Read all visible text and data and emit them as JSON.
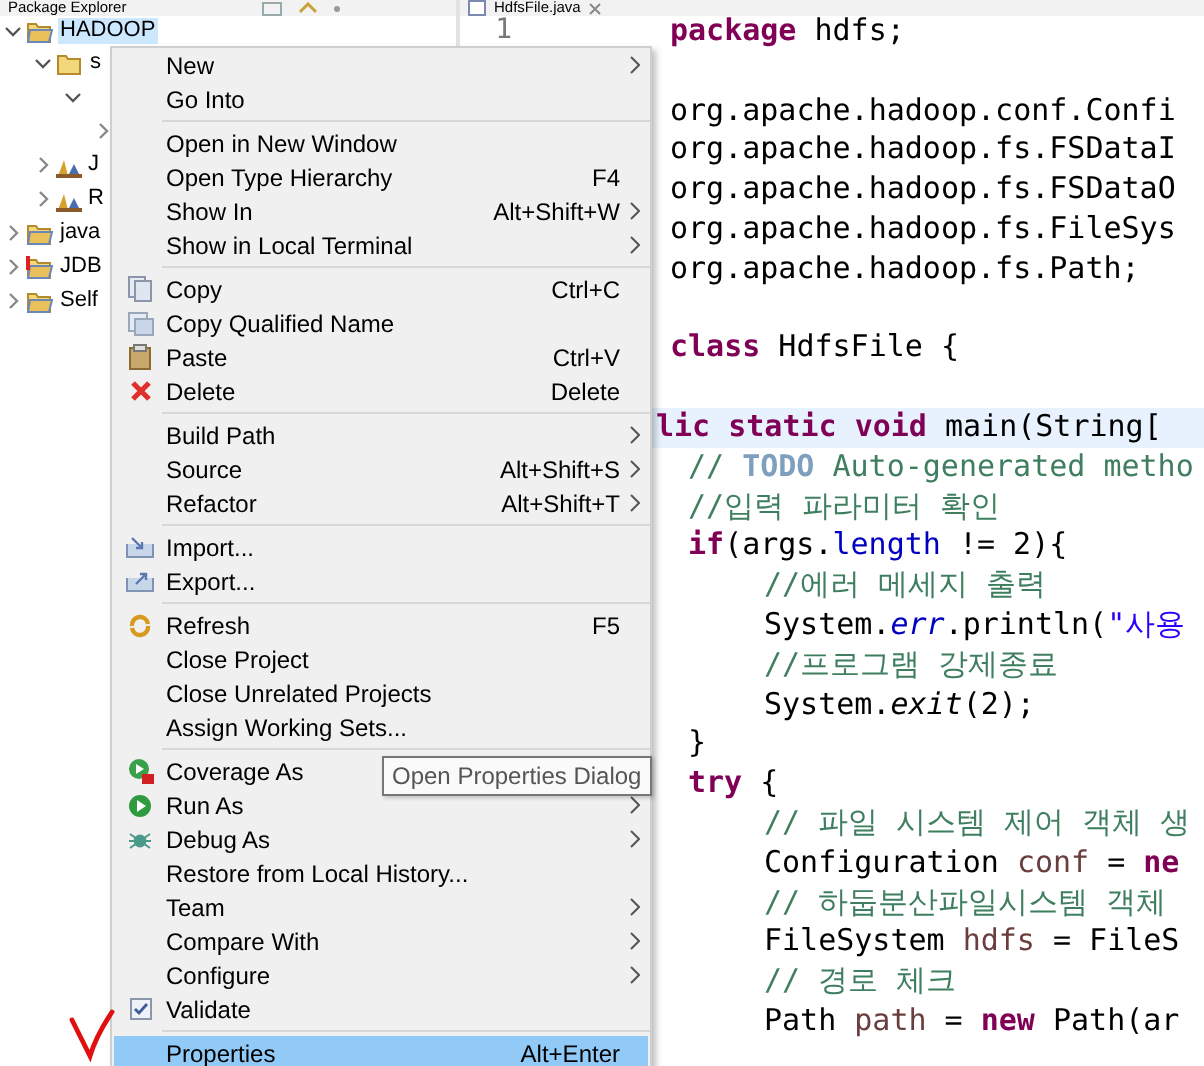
{
  "tabs": [
    {
      "label": "Package Explorer",
      "selected": true
    },
    {
      "label": "HdfsFile.java",
      "selected": true
    }
  ],
  "tree": [
    {
      "label": "HADOOP",
      "kind": "project",
      "expanded": true,
      "selected": true,
      "error": false,
      "children": [
        {
          "label": "s",
          "kind": "source-folder",
          "expanded": true,
          "selected": false,
          "children": [
            {
              "expanded": true,
              "children": [
                {
                  "expanded": false
                }
              ]
            }
          ]
        },
        {
          "label": "J",
          "kind": "library",
          "expanded": false,
          "selected": false
        },
        {
          "label": "R",
          "kind": "library",
          "expanded": false,
          "selected": false
        }
      ]
    },
    {
      "label": "java",
      "kind": "project",
      "expanded": false,
      "selected": false,
      "error": false
    },
    {
      "label": "JDB",
      "kind": "project",
      "expanded": false,
      "selected": false,
      "error": true
    },
    {
      "label": "Self",
      "kind": "project",
      "expanded": false,
      "selected": false,
      "error": false
    }
  ],
  "editor": {
    "line_numbers": [
      "1"
    ],
    "lines": [
      {
        "kind": "code",
        "tokens": [
          {
            "kind": "keyword",
            "text": "package"
          },
          {
            "kind": "plain",
            "text": " hdfs;"
          }
        ]
      },
      {
        "kind": "blank"
      },
      {
        "kind": "code",
        "tokens": [
          {
            "kind": "plain",
            "text": "org.apache.hadoop.conf.Confi"
          }
        ]
      },
      {
        "kind": "code",
        "tokens": [
          {
            "kind": "plain",
            "text": "org.apache.hadoop.fs.FSDataI"
          }
        ]
      },
      {
        "kind": "code",
        "tokens": [
          {
            "kind": "plain",
            "text": "org.apache.hadoop.fs.FSDataO"
          }
        ]
      },
      {
        "kind": "code",
        "tokens": [
          {
            "kind": "plain",
            "text": "org.apache.hadoop.fs.FileSys"
          }
        ]
      },
      {
        "kind": "code",
        "tokens": [
          {
            "kind": "plain",
            "text": "org.apache.hadoop.fs.Path;"
          }
        ]
      },
      {
        "kind": "blank"
      },
      {
        "kind": "code",
        "tokens": [
          {
            "kind": "keyword",
            "text": "class"
          },
          {
            "kind": "plain",
            "text": " HdfsFile {"
          }
        ]
      },
      {
        "kind": "blank"
      },
      {
        "kind": "code",
        "current": true,
        "tokens": [
          {
            "kind": "keyword",
            "text": "lic static void"
          },
          {
            "kind": "plain",
            "text": " main(String["
          }
        ],
        "children": [
          {
            "kind": "code",
            "tokens": [
              {
                "kind": "comment",
                "text": "// "
              },
              {
                "kind": "task",
                "text": "TODO"
              },
              {
                "kind": "comment",
                "text": " Auto-generated metho"
              }
            ]
          },
          {
            "kind": "code",
            "tokens": [
              {
                "kind": "comment",
                "text": "//입력 파라미터 확인"
              }
            ]
          },
          {
            "kind": "code",
            "tokens": [
              {
                "kind": "keyword",
                "text": "if"
              },
              {
                "kind": "plain",
                "text": "(args."
              },
              {
                "kind": "field",
                "text": "length"
              },
              {
                "kind": "plain",
                "text": " != 2){"
              }
            ],
            "children": [
              {
                "kind": "code",
                "tokens": [
                  {
                    "kind": "comment",
                    "text": "//에러 메세지 출력"
                  }
                ]
              },
              {
                "kind": "code",
                "tokens": [
                  {
                    "kind": "plain",
                    "text": "System."
                  },
                  {
                    "kind": "static-field",
                    "text": "err"
                  },
                  {
                    "kind": "plain",
                    "text": ".println("
                  },
                  {
                    "kind": "string",
                    "text": "\"사용"
                  }
                ]
              },
              {
                "kind": "code",
                "tokens": [
                  {
                    "kind": "comment",
                    "text": "//프로그램 강제종료"
                  }
                ]
              },
              {
                "kind": "code",
                "tokens": [
                  {
                    "kind": "plain",
                    "text": "System."
                  },
                  {
                    "kind": "static-method",
                    "text": "exit"
                  },
                  {
                    "kind": "plain",
                    "text": "(2);"
                  }
                ]
              }
            ]
          },
          {
            "kind": "code",
            "tokens": [
              {
                "kind": "plain",
                "text": "}"
              }
            ]
          },
          {
            "kind": "code",
            "tokens": [
              {
                "kind": "keyword",
                "text": "try"
              },
              {
                "kind": "plain",
                "text": " {"
              }
            ],
            "children": [
              {
                "kind": "code",
                "tokens": [
                  {
                    "kind": "comment",
                    "text": "// 파일 시스템 제어 객체 생"
                  }
                ]
              },
              {
                "kind": "code",
                "tokens": [
                  {
                    "kind": "plain",
                    "text": "Configuration "
                  },
                  {
                    "kind": "variable",
                    "text": "conf"
                  },
                  {
                    "kind": "plain",
                    "text": " = "
                  },
                  {
                    "kind": "keyword",
                    "text": "ne"
                  }
                ]
              },
              {
                "kind": "code",
                "tokens": [
                  {
                    "kind": "comment",
                    "text": "// 하둡분산파일시스템 객체"
                  }
                ]
              },
              {
                "kind": "code",
                "tokens": [
                  {
                    "kind": "plain",
                    "text": "FileSystem "
                  },
                  {
                    "kind": "variable",
                    "text": "hdfs"
                  },
                  {
                    "kind": "plain",
                    "text": " = FileS"
                  }
                ]
              },
              {
                "kind": "code",
                "tokens": [
                  {
                    "kind": "comment",
                    "text": "// 경로 체크"
                  }
                ]
              },
              {
                "kind": "code",
                "tokens": [
                  {
                    "kind": "plain",
                    "text": "Path "
                  },
                  {
                    "kind": "variable",
                    "text": "path"
                  },
                  {
                    "kind": "plain",
                    "text": " = "
                  },
                  {
                    "kind": "keyword",
                    "text": "new"
                  },
                  {
                    "kind": "plain",
                    "text": " Path(ar"
                  }
                ]
              }
            ]
          }
        ]
      }
    ]
  },
  "context_menu": [
    {
      "kind": "item",
      "label": "New",
      "submenu": true,
      "selected": false
    },
    {
      "kind": "item",
      "label": "Go Into",
      "submenu": false,
      "selected": false
    },
    {
      "kind": "separator"
    },
    {
      "kind": "item",
      "label": "Open in New Window",
      "submenu": false,
      "selected": false
    },
    {
      "kind": "item",
      "label": "Open Type Hierarchy",
      "shortcut": "F4",
      "submenu": false,
      "selected": false
    },
    {
      "kind": "item",
      "label": "Show In",
      "shortcut": "Alt+Shift+W",
      "submenu": true,
      "selected": false
    },
    {
      "kind": "item",
      "label": "Show in Local Terminal",
      "submenu": true,
      "selected": false
    },
    {
      "kind": "separator"
    },
    {
      "kind": "item",
      "label": "Copy",
      "shortcut": "Ctrl+C",
      "submenu": false,
      "selected": false
    },
    {
      "kind": "item",
      "label": "Copy Qualified Name",
      "submenu": false,
      "selected": false
    },
    {
      "kind": "item",
      "label": "Paste",
      "shortcut": "Ctrl+V",
      "submenu": false,
      "selected": false
    },
    {
      "kind": "item",
      "label": "Delete",
      "shortcut": "Delete",
      "submenu": false,
      "selected": false
    },
    {
      "kind": "separator"
    },
    {
      "kind": "item",
      "label": "Build Path",
      "submenu": true,
      "selected": false
    },
    {
      "kind": "item",
      "label": "Source",
      "shortcut": "Alt+Shift+S",
      "submenu": true,
      "selected": false
    },
    {
      "kind": "item",
      "label": "Refactor",
      "shortcut": "Alt+Shift+T",
      "submenu": true,
      "selected": false
    },
    {
      "kind": "separator"
    },
    {
      "kind": "item",
      "label": "Import...",
      "submenu": false,
      "selected": false
    },
    {
      "kind": "item",
      "label": "Export...",
      "submenu": false,
      "selected": false
    },
    {
      "kind": "separator"
    },
    {
      "kind": "item",
      "label": "Refresh",
      "shortcut": "F5",
      "submenu": false,
      "selected": false
    },
    {
      "kind": "item",
      "label": "Close Project",
      "submenu": false,
      "selected": false
    },
    {
      "kind": "item",
      "label": "Close Unrelated Projects",
      "submenu": false,
      "selected": false
    },
    {
      "kind": "item",
      "label": "Assign Working Sets...",
      "submenu": false,
      "selected": false
    },
    {
      "kind": "separator"
    },
    {
      "kind": "item",
      "label": "Coverage As",
      "submenu": false,
      "selected": false
    },
    {
      "kind": "item",
      "label": "Run As",
      "submenu": true,
      "selected": false
    },
    {
      "kind": "item",
      "label": "Debug As",
      "submenu": true,
      "selected": false
    },
    {
      "kind": "item",
      "label": "Restore from Local History...",
      "submenu": false,
      "selected": false
    },
    {
      "kind": "item",
      "label": "Team",
      "submenu": true,
      "selected": false
    },
    {
      "kind": "item",
      "label": "Compare With",
      "submenu": true,
      "selected": false
    },
    {
      "kind": "item",
      "label": "Configure",
      "submenu": true,
      "selected": false
    },
    {
      "kind": "item",
      "label": "Validate",
      "submenu": false,
      "selected": false
    },
    {
      "kind": "separator"
    },
    {
      "kind": "item",
      "label": "Properties",
      "shortcut": "Alt+Enter",
      "submenu": false,
      "selected": true
    }
  ],
  "tooltip": {
    "text": "Open Properties Dialog"
  }
}
